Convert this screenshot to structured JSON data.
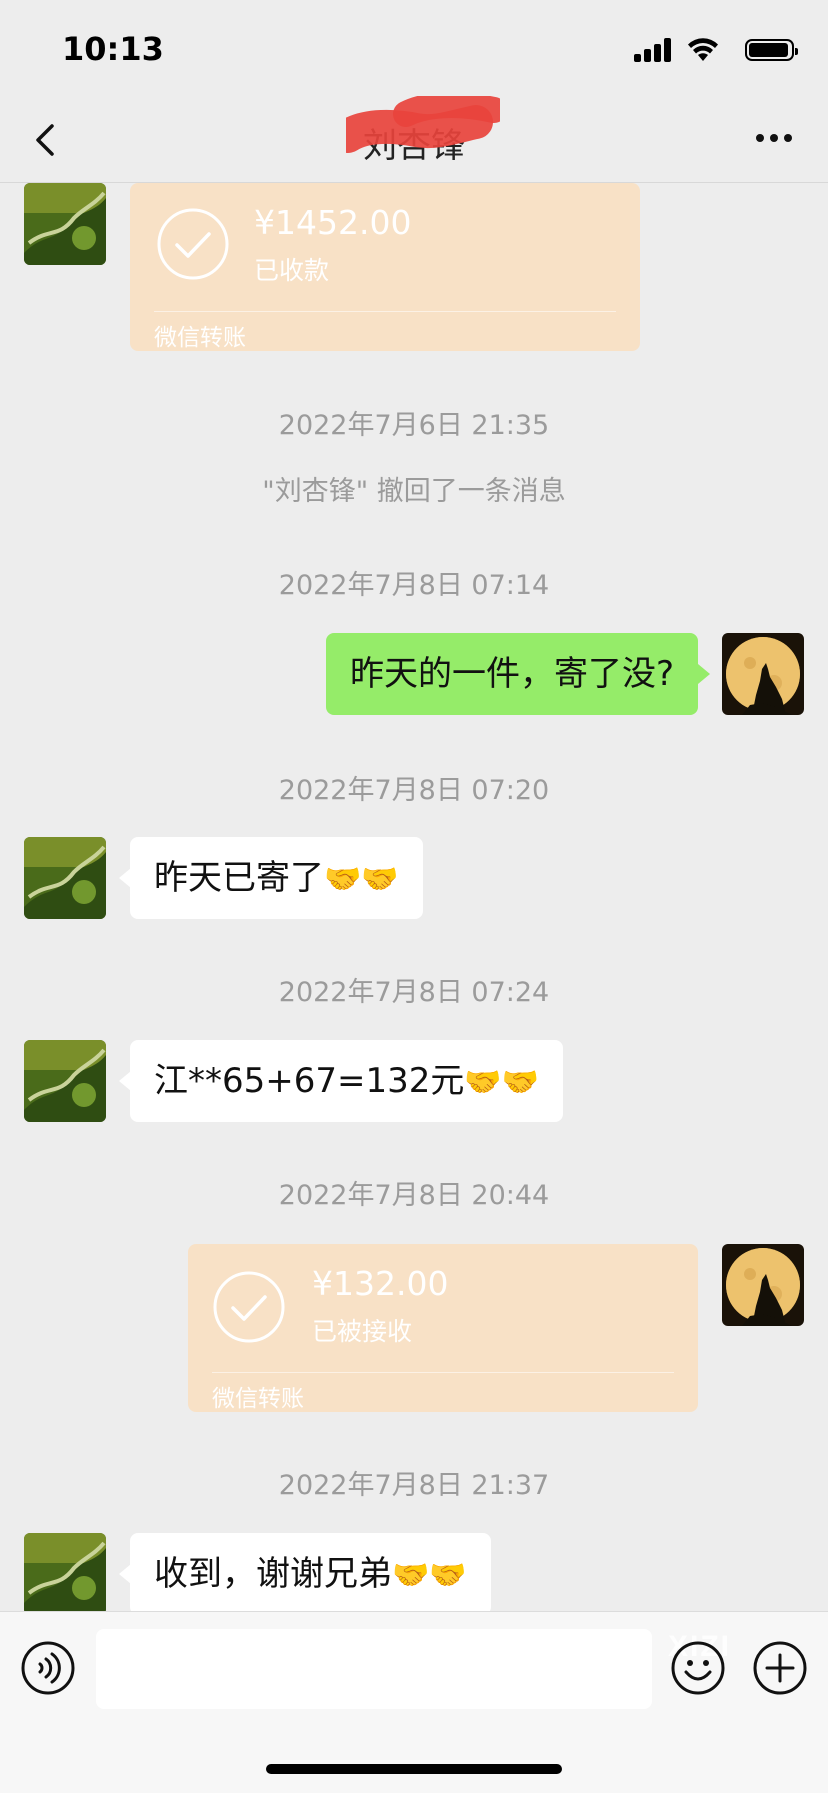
{
  "status_bar": {
    "time": "10:13"
  },
  "header": {
    "title": "刘杏锋"
  },
  "messages": {
    "transfer_1": {
      "amount": "¥1452.00",
      "status": "已收款",
      "label": "微信转账"
    },
    "ts_1": "2022年7月6日 21:35",
    "recall_notice": "\"刘杏锋\" 撤回了一条消息",
    "ts_2": "2022年7月8日 07:14",
    "msg_out_1": "昨天的一件，寄了没?",
    "ts_3": "2022年7月8日 07:20",
    "msg_in_1": "昨天已寄了",
    "msg_in_1_emoji": "🤝🤝",
    "ts_4": "2022年7月8日 07:24",
    "msg_in_2": "江**65+67=132元",
    "msg_in_2_emoji": "🤝🤝",
    "ts_5": "2022年7月8日 20:44",
    "transfer_2": {
      "amount": "¥132.00",
      "status": "已被接收",
      "label": "微信转账"
    },
    "ts_6": "2022年7月8日 21:37",
    "msg_in_3": "收到，谢谢兄弟",
    "msg_in_3_emoji": "🤝🤝"
  },
  "input_bar": {
    "placeholder": "",
    "watermark": "XIZI"
  },
  "colors": {
    "background": "#ededed",
    "outgoing_bubble": "#95ec69",
    "incoming_bubble": "#ffffff",
    "transfer_card": "#f8e1c6",
    "redaction": "#e8433c"
  },
  "icons": {
    "back": "chevron-left-icon",
    "more": "more-dots-icon",
    "voice": "voice-icon",
    "emoji": "emoji-icon",
    "plus": "plus-icon",
    "transfer_check": "check-circle-icon"
  }
}
